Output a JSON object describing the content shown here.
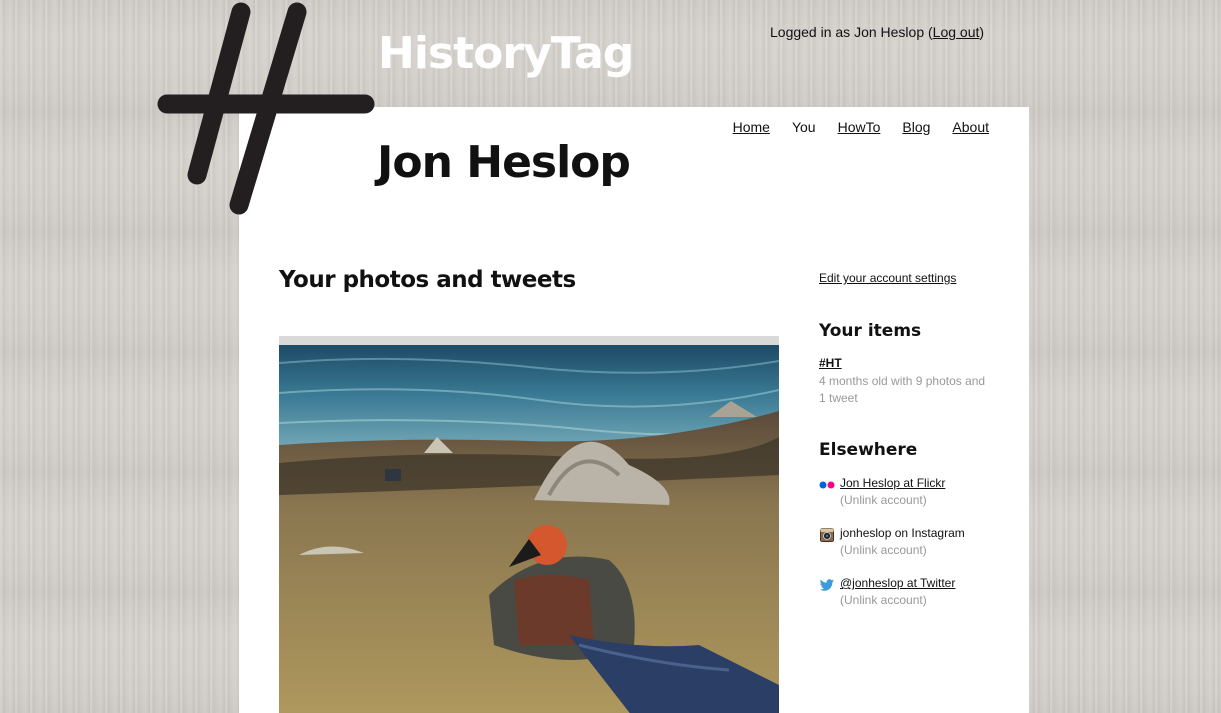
{
  "header": {
    "logged_in_prefix": "Logged in as Jon Heslop (",
    "logout_label": "Log out",
    "logged_in_suffix": ")",
    "site_title": "HistoryTag"
  },
  "nav": {
    "items": [
      {
        "label": "Home"
      },
      {
        "label": "You"
      },
      {
        "label": "HowTo"
      },
      {
        "label": "Blog"
      },
      {
        "label": "About"
      }
    ]
  },
  "profile": {
    "name": "Jon Heslop"
  },
  "main": {
    "heading": "Your photos and tweets"
  },
  "sidebar": {
    "settings_link": "Edit your account settings",
    "items_heading": "Your items",
    "item_title": "#HT",
    "item_description": "4 months old with 9 photos and 1 tweet",
    "elsewhere_heading": "Elsewhere",
    "accounts": [
      {
        "service_icon": "flickr-icon",
        "label": "Jon Heslop at Flickr",
        "unlink": "(Unlink account)"
      },
      {
        "service_icon": "instagram-icon",
        "label": "jonheslop on Instagram",
        "unlink": "(Unlink account)"
      },
      {
        "service_icon": "twitter-icon",
        "label": "@jonheslop at Twitter",
        "unlink": "(Unlink account)"
      }
    ]
  },
  "colors": {
    "background": "#d4d0cb",
    "panel": "#ffffff",
    "text": "#111111",
    "muted": "#999999",
    "flickr_blue": "#0063dc",
    "flickr_pink": "#ff0084",
    "twitter_blue": "#3b9cd9"
  }
}
